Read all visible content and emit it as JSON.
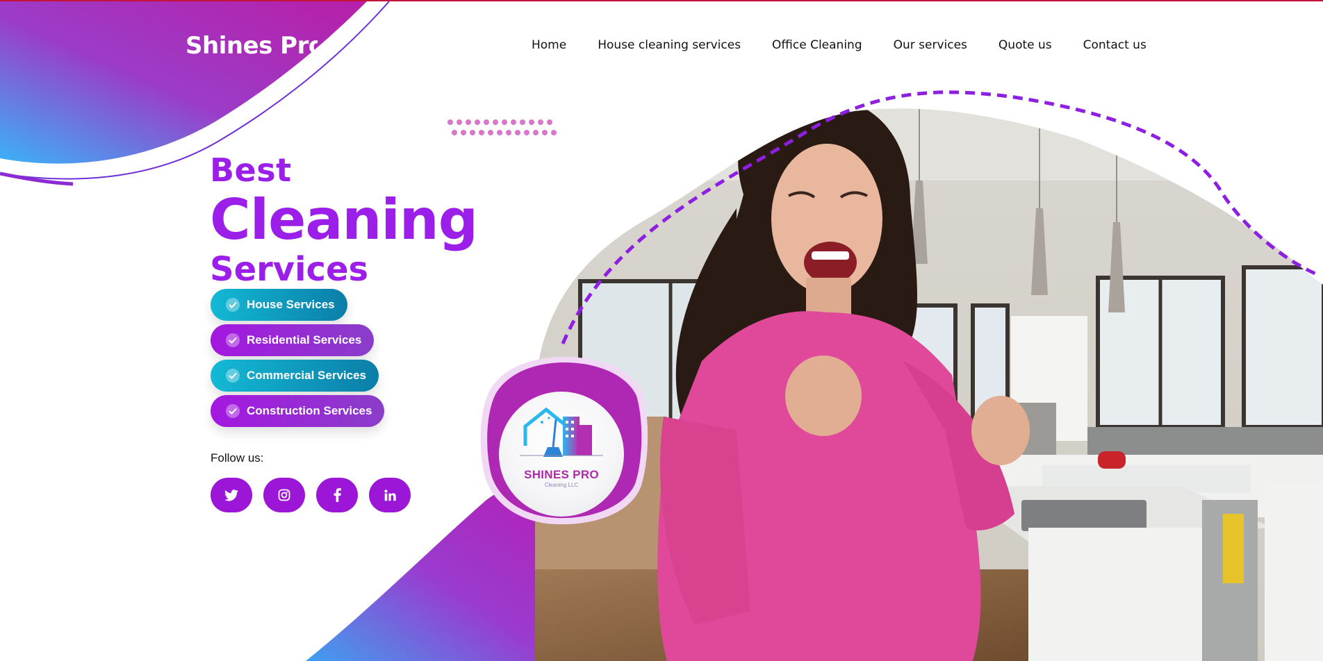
{
  "brand": {
    "name": "Shines Pro"
  },
  "nav": {
    "items": [
      {
        "label": "Home"
      },
      {
        "label": "House cleaning services"
      },
      {
        "label": "Office Cleaning"
      },
      {
        "label": "Our services"
      },
      {
        "label": "Quote us"
      },
      {
        "label": "Contact us"
      }
    ]
  },
  "hero": {
    "line1": "Best",
    "line2": "Cleaning",
    "line3": "Services",
    "services": [
      {
        "label": "House Services",
        "style": "teal"
      },
      {
        "label": "Residential Services",
        "style": "purple"
      },
      {
        "label": "Commercial Services",
        "style": "teal"
      },
      {
        "label": "Construction Services",
        "style": "purple"
      }
    ],
    "follow_label": "Follow us:",
    "social_icons": [
      "twitter-icon",
      "instagram-icon",
      "facebook-icon",
      "linkedin-icon"
    ]
  },
  "logo_badge": {
    "title": "SHINES PRO",
    "subtitle": "Cleaning LLC"
  },
  "colors": {
    "accent_purple": "#9b1fe8",
    "accent_teal": "#13b9d5",
    "blob_magenta": "#b01eb4",
    "blob_blue": "#3aa8f5",
    "top_border": "#c4133a"
  }
}
